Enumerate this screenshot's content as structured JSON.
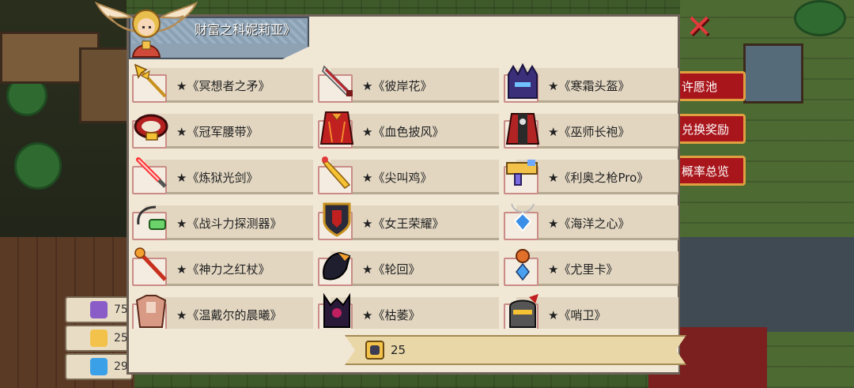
{
  "title": "财富之科妮莉亚》",
  "close_icon": "close-x-icon",
  "resources": [
    {
      "name": "purple-crystal-icon",
      "value": "75",
      "color": "#8a5cc7"
    },
    {
      "name": "coin-icon",
      "value": "25",
      "color": "#f2c24a"
    },
    {
      "name": "diamond-icon",
      "value": "29",
      "color": "#3aa0e8"
    }
  ],
  "side_menu": [
    "许愿池",
    "兑换奖励",
    "概率总览"
  ],
  "items": [
    {
      "label": "★《冥想者之矛》",
      "icon": "golden-spear-icon"
    },
    {
      "label": "★《彼岸花》",
      "icon": "red-blade-icon"
    },
    {
      "label": "★《寒霜头盔》",
      "icon": "frost-helmet-icon"
    },
    {
      "label": "★《冠军腰带》",
      "icon": "champion-belt-icon"
    },
    {
      "label": "★《血色披风》",
      "icon": "crimson-cape-icon"
    },
    {
      "label": "★《巫师长袍》",
      "icon": "wizard-robe-icon"
    },
    {
      "label": "★《炼狱光剑》",
      "icon": "red-lightsaber-icon"
    },
    {
      "label": "★《尖叫鸡》",
      "icon": "screaming-chicken-icon"
    },
    {
      "label": "★《利奥之枪Pro》",
      "icon": "leo-gun-icon"
    },
    {
      "label": "★《战斗力探测器》",
      "icon": "scouter-icon"
    },
    {
      "label": "★《女王荣耀》",
      "icon": "queen-shield-icon"
    },
    {
      "label": "★《海洋之心》",
      "icon": "ocean-heart-icon"
    },
    {
      "label": "★《神力之红杖》",
      "icon": "red-staff-icon"
    },
    {
      "label": "★《轮回》",
      "icon": "reincarnation-gauntlet-icon"
    },
    {
      "label": "★《尤里卡》",
      "icon": "eureka-amulet-icon"
    },
    {
      "label": "★《温戴尔的晨曦》",
      "icon": "dawn-armor-icon"
    },
    {
      "label": "★《枯萎》",
      "icon": "withered-icon"
    },
    {
      "label": "★《哨卫》",
      "icon": "sentinel-helmet-icon"
    }
  ],
  "bottom": {
    "icon": "coin-icon",
    "value": "25"
  }
}
